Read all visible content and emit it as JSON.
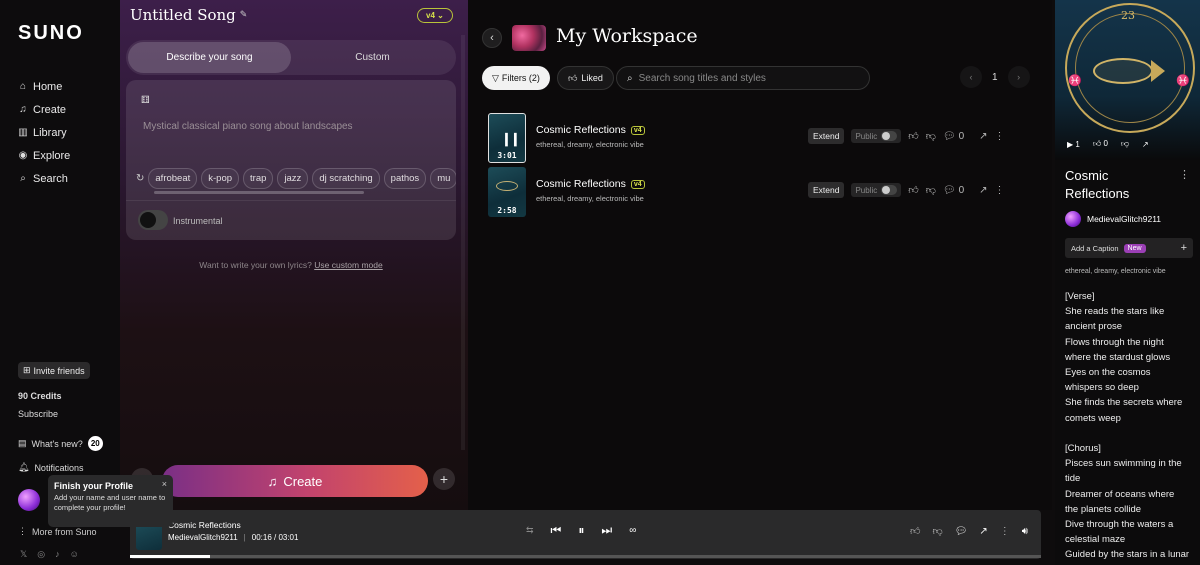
{
  "nav": {
    "logo": "SUNO",
    "items": [
      {
        "label": "Home",
        "icon": "home-icon"
      },
      {
        "label": "Create",
        "icon": "music-note-icon"
      },
      {
        "label": "Library",
        "icon": "library-icon"
      },
      {
        "label": "Explore",
        "icon": "compass-icon"
      },
      {
        "label": "Search",
        "icon": "search-icon"
      }
    ],
    "invite_label": "Invite friends",
    "credits": "90 Credits",
    "subscribe": "Subscribe",
    "whats_new": "What's new?",
    "whats_new_count": "20",
    "notifications": "Notifications",
    "more": "More from Suno",
    "toast": {
      "title": "Finish your Profile",
      "body": "Add your name and user name to complete your profile!"
    }
  },
  "create": {
    "title": "Untitled Song",
    "model": "v4",
    "tabs": [
      "Describe your song",
      "Custom"
    ],
    "placeholder": "Mystical classical piano song about landscapes",
    "chips": [
      "afrobeat",
      "k-pop",
      "trap",
      "jazz",
      "dj scratching",
      "pathos",
      "mu"
    ],
    "instrumental_label": "Instrumental",
    "instrumental_on": false,
    "lyrics_hint": "Want to write your own lyrics?",
    "lyrics_link": "Use custom mode",
    "create_label": "Create"
  },
  "workspace": {
    "title": "My Workspace",
    "filters_label": "Filters (2)",
    "liked_label": "Liked",
    "search_placeholder": "Search song titles and styles",
    "page": "1",
    "songs": [
      {
        "title": "Cosmic Reflections",
        "model": "v4",
        "tags": "ethereal, dreamy, electronic vibe",
        "duration": "3:01",
        "extend": "Extend",
        "public": "Public",
        "comments": "0",
        "playing": true
      },
      {
        "title": "Cosmic Reflections",
        "model": "v4",
        "tags": "ethereal, dreamy, electronic vibe",
        "duration": "2:58",
        "extend": "Extend",
        "public": "Public",
        "comments": "0",
        "playing": false
      }
    ]
  },
  "detail": {
    "art_number": "23",
    "plays": "1",
    "likes": "0",
    "title": "Cosmic Reflections",
    "user": "MedievalGlitch9211",
    "caption_label": "Add a Caption",
    "caption_badge": "New",
    "tags": "ethereal, dreamy, electronic vibe",
    "lyrics": [
      "[Verse]",
      "She reads the stars like",
      "ancient prose",
      "Flows through the night",
      "where the stardust glows",
      "Eyes on the cosmos",
      "whispers so deep",
      "She finds the secrets where",
      "comets weep",
      "",
      "[Chorus]",
      "Pisces sun swimming in the",
      "tide",
      "Dreamer of oceans where",
      "the planets collide",
      "Dive through the waters a",
      "celestial maze",
      "Guided by the stars in a lunar"
    ]
  },
  "player": {
    "title": "Cosmic Reflections",
    "user": "MedievalGlitch9211",
    "time": "00:16 / 03:01",
    "progress_fraction": 0.088
  }
}
